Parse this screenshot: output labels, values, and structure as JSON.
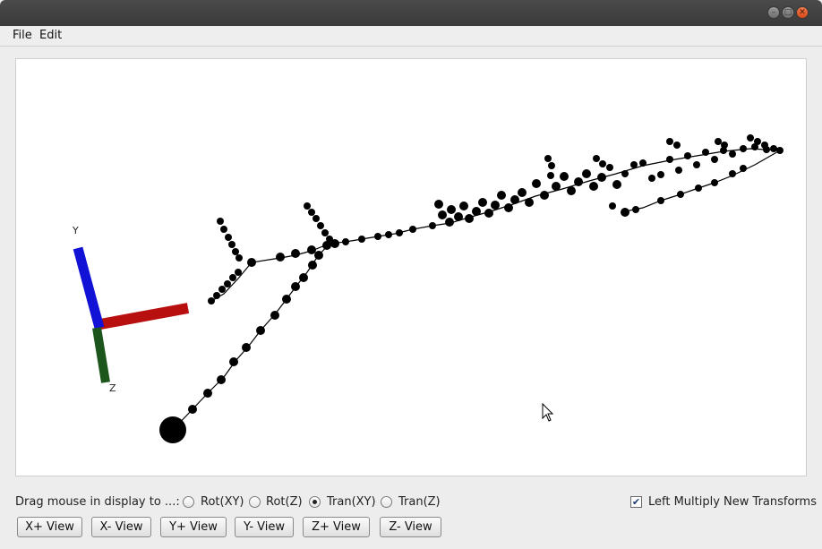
{
  "menu": {
    "file": "File",
    "edit": "Edit"
  },
  "window_controls": {
    "minimize": "minimize-icon",
    "maximize": "maximize-icon",
    "close": "close-icon"
  },
  "axes": {
    "y_label": "Y",
    "z_label": "Z",
    "x_color": "#c81010",
    "y_color": "#1010d8",
    "z_color": "#1e5a1e"
  },
  "controls": {
    "drag_label": "Drag mouse in display to ...:",
    "modes": [
      {
        "label": "Rot(XY)",
        "selected": false
      },
      {
        "label": "Rot(Z)",
        "selected": false
      },
      {
        "label": "Tran(XY)",
        "selected": true
      },
      {
        "label": "Tran(Z)",
        "selected": false
      }
    ],
    "left_multiply": {
      "label": "Left Multiply New Transforms",
      "checked": true
    }
  },
  "buttons": [
    {
      "label": "X+ View"
    },
    {
      "label": "X- View"
    },
    {
      "label": "Y+ View"
    },
    {
      "label": "Y- View"
    },
    {
      "label": "Z+ View"
    },
    {
      "label": "Z- View"
    }
  ]
}
